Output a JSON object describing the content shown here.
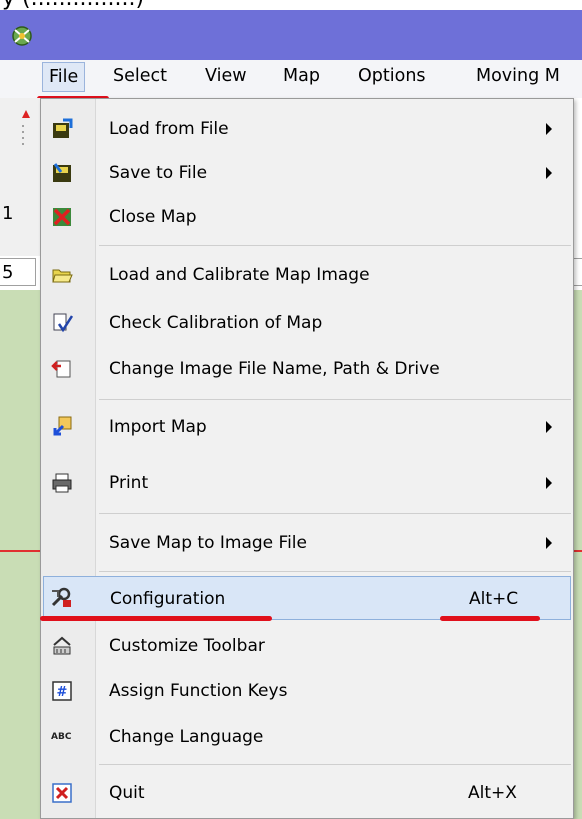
{
  "menubar": {
    "items": [
      "File",
      "Select",
      "View",
      "Map",
      "Options",
      "Moving M"
    ]
  },
  "side": {
    "digit": "1",
    "field_value": "5"
  },
  "file_menu": {
    "items": [
      {
        "label": "Load from File",
        "icon": "load-file-icon",
        "submenu": true
      },
      {
        "label": "Save to File",
        "icon": "save-file-icon",
        "submenu": true
      },
      {
        "label": "Close Map",
        "icon": "close-map-icon"
      },
      {
        "label": "Load and Calibrate Map Image",
        "icon": "open-folder-icon"
      },
      {
        "label": "Check Calibration of Map",
        "icon": "check-calibration-icon"
      },
      {
        "label": "Change Image File Name, Path & Drive",
        "icon": "change-path-icon"
      },
      {
        "label": "Import Map",
        "icon": "import-map-icon",
        "submenu": true
      },
      {
        "label": "Print",
        "icon": "printer-icon",
        "submenu": true
      },
      {
        "label": "Save Map to Image File",
        "icon": "",
        "submenu": true
      },
      {
        "label": "Configuration",
        "icon": "configuration-icon",
        "shortcut": "Alt+C",
        "highlighted": true
      },
      {
        "label": "Customize Toolbar",
        "icon": "customize-toolbar-icon"
      },
      {
        "label": "Assign Function Keys",
        "icon": "function-keys-icon"
      },
      {
        "label": "Change Language",
        "icon": "language-icon",
        "icon_text": "ABC"
      },
      {
        "label": "Quit",
        "icon": "quit-icon",
        "shortcut": "Alt+X"
      }
    ]
  },
  "colors": {
    "titlebar": "#6e70d8",
    "highlight": "#d9e6f7",
    "annotation": "#e0101c"
  }
}
